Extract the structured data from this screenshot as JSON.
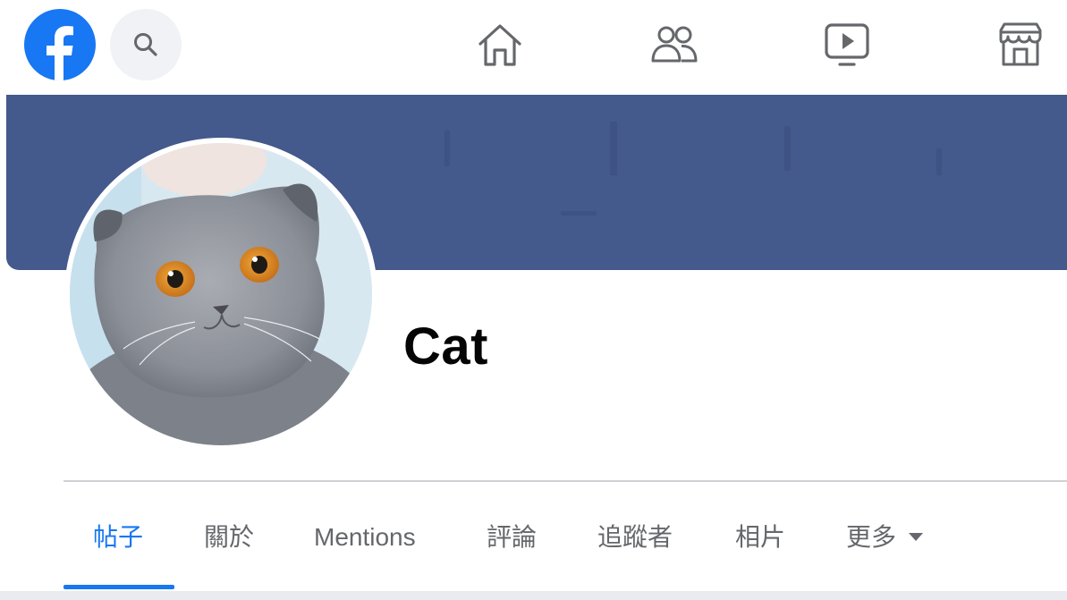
{
  "profile": {
    "name": "Cat"
  },
  "tabs": [
    {
      "label": "帖子",
      "active": true
    },
    {
      "label": "關於",
      "active": false
    },
    {
      "label": "Mentions",
      "active": false
    },
    {
      "label": "評論",
      "active": false
    },
    {
      "label": "追蹤者",
      "active": false
    },
    {
      "label": "相片",
      "active": false
    },
    {
      "label": "更多",
      "active": false
    }
  ],
  "icons": {
    "logo": "facebook-logo-icon",
    "search": "search-icon",
    "home": "home-icon",
    "friends": "friends-icon",
    "watch": "watch-icon",
    "marketplace": "marketplace-icon",
    "more_caret": "caret-down-icon"
  },
  "colors": {
    "brand": "#1877f2",
    "cover": "#44598c",
    "tab_inactive": "#65676b",
    "text": "#050505"
  }
}
